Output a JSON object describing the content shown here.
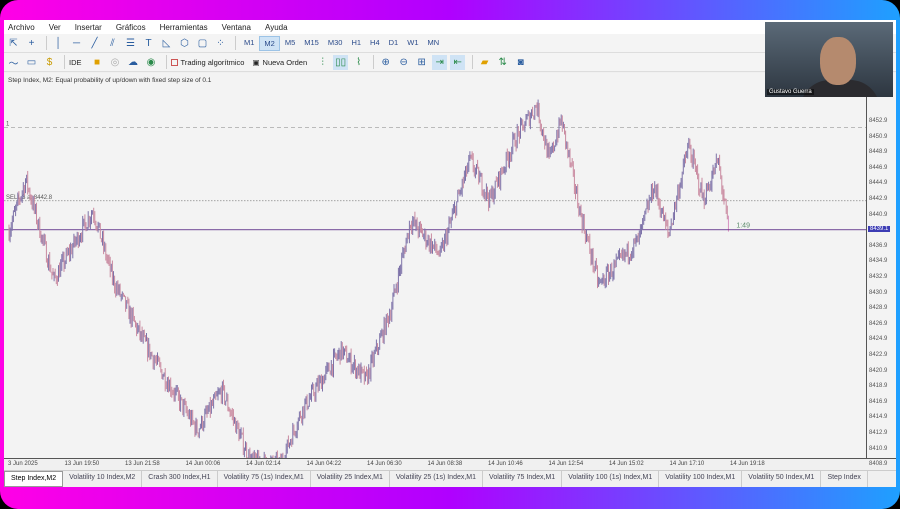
{
  "menu": [
    "Archivo",
    "Ver",
    "Insertar",
    "Gráficos",
    "Herramientas",
    "Ventana",
    "Ayuda"
  ],
  "timeframes": [
    "M1",
    "M2",
    "M5",
    "M15",
    "M30",
    "H1",
    "H4",
    "D1",
    "W1",
    "MN"
  ],
  "active_timeframe": "M2",
  "toolbar2": {
    "ide": "IDE",
    "algo": "Trading algorítmico",
    "order": "Nueva Orden"
  },
  "chart": {
    "title": "Step Index, M2:  Equal probability of up/down with fixed step size of 0.1",
    "sell_label": "SELL 3 at 8442.8",
    "sell_price": 8442.8,
    "current_price": 8439.1,
    "current_label": "8439.1",
    "top_line_label": "1",
    "top_line_price": 8452.2,
    "countdown": "1:49",
    "price_ticks": [
      "8452.9",
      "8450.9",
      "8448.9",
      "8446.9",
      "8444.9",
      "8442.9",
      "8440.9",
      "8436.9",
      "8434.9",
      "8432.9",
      "8430.9",
      "8428.9",
      "8426.9",
      "8424.9",
      "8422.9",
      "8420.9",
      "8418.9",
      "8416.9",
      "8414.9",
      "8412.9",
      "8410.9",
      "8408.9"
    ],
    "time_ticks": [
      "3 Jun 2025",
      "13 Jun 19:50",
      "13 Jun 21:58",
      "14 Jun 00:06",
      "14 Jun 02:14",
      "14 Jun 04:22",
      "14 Jun 06:30",
      "14 Jun 08:38",
      "14 Jun 10:46",
      "14 Jun 12:54",
      "14 Jun 15:02",
      "14 Jun 17:10",
      "14 Jun 19:18"
    ],
    "price_path": [
      [
        0,
        8439.0
      ],
      [
        0.28,
        8445.5
      ],
      [
        0.74,
        8432.6
      ],
      [
        1.39,
        8441.6
      ],
      [
        1.72,
        8432.6
      ],
      [
        2.21,
        8424.9
      ],
      [
        3.11,
        8413.4
      ],
      [
        3.52,
        8418.5
      ],
      [
        3.98,
        8409.5
      ],
      [
        4.48,
        8408.9
      ],
      [
        4.84,
        8415.9
      ],
      [
        5.49,
        8423.6
      ],
      [
        5.9,
        8419.8
      ],
      [
        6.31,
        8428.8
      ],
      [
        6.64,
        8440.3
      ],
      [
        7.13,
        8435.8
      ],
      [
        7.62,
        8448.0
      ],
      [
        7.95,
        8442.9
      ],
      [
        8.36,
        8450.6
      ],
      [
        8.72,
        8455.1
      ],
      [
        8.93,
        8448.0
      ],
      [
        9.13,
        8453.2
      ],
      [
        9.43,
        8441.6
      ],
      [
        9.75,
        8432.0
      ],
      [
        10.41,
        8437.8
      ],
      [
        10.66,
        8444.8
      ],
      [
        10.9,
        8438.4
      ],
      [
        11.23,
        8449.9
      ],
      [
        11.48,
        8442.9
      ],
      [
        11.72,
        8448.0
      ],
      [
        11.89,
        8439.1
      ]
    ],
    "colors": {
      "bull": "#7d72a8",
      "bear": "#c98aa0",
      "price_line": "#8a6aa8"
    }
  },
  "tabs": [
    "Step Index,M2",
    "Volatility 10 Index,M2",
    "Crash 300 Index,H1",
    "Volatility 75 (1s) Index,M1",
    "Volatility 25 Index,M1",
    "Volatility 25 (1s) Index,M1",
    "Volatility 75 Index,M1",
    "Volatility 100 (1s) Index,M1",
    "Volatility 100 Index,M1",
    "Volatility 50 Index,M1",
    "Step Index"
  ],
  "webcam": {
    "name": "Gustavo Guerra"
  }
}
